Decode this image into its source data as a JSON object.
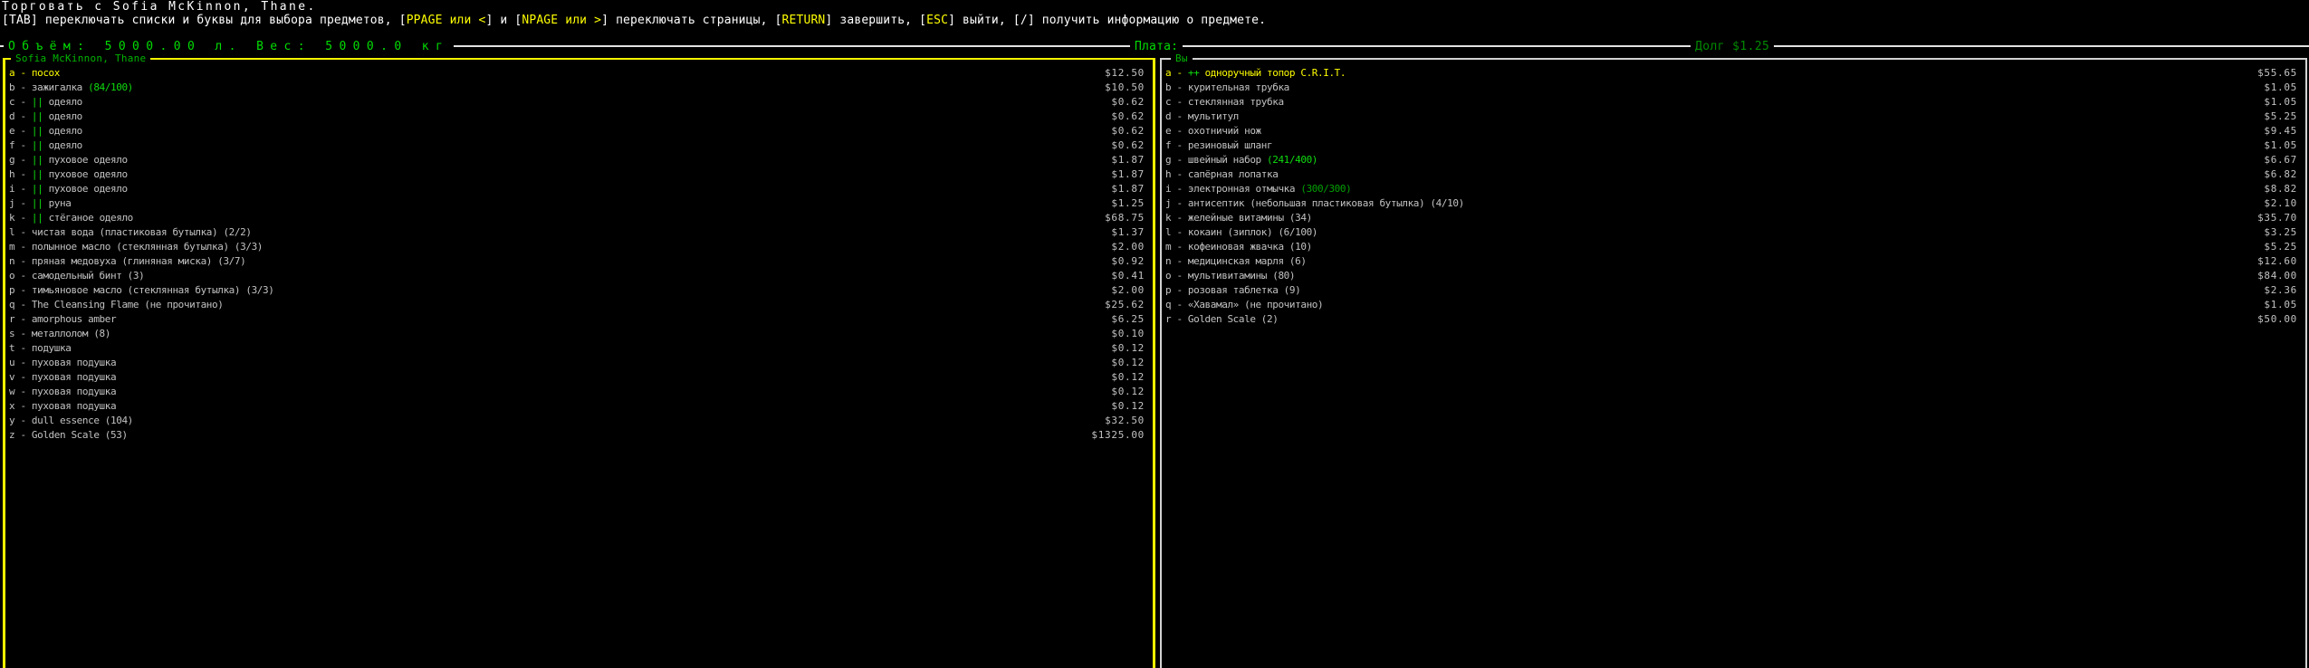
{
  "header": {
    "title": "Торговать с Sofia McKinnon, Thane.",
    "help_segments": [
      {
        "t": "[TAB] переключать списки и буквы для выбора предметов, ",
        "c": "white"
      },
      {
        "t": "[",
        "c": "white"
      },
      {
        "t": "PPAGE или <",
        "c": "yellow"
      },
      {
        "t": "]",
        "c": "white"
      },
      {
        "t": " и ",
        "c": "white"
      },
      {
        "t": "[",
        "c": "white"
      },
      {
        "t": "NPAGE или >",
        "c": "yellow"
      },
      {
        "t": "]",
        "c": "white"
      },
      {
        "t": " переключать страницы, ",
        "c": "white"
      },
      {
        "t": "[",
        "c": "white"
      },
      {
        "t": "RETURN",
        "c": "yellow"
      },
      {
        "t": "]",
        "c": "white"
      },
      {
        "t": " завершить, ",
        "c": "white"
      },
      {
        "t": "[",
        "c": "white"
      },
      {
        "t": "ESC",
        "c": "yellow"
      },
      {
        "t": "]",
        "c": "white"
      },
      {
        "t": " выйти, ",
        "c": "white"
      },
      {
        "t": "[/] получить информацию о предмете.",
        "c": "white"
      }
    ]
  },
  "status_bar": {
    "volume_weight": "Объём: 5000.00 л. Вес: 5000.0 кг",
    "payment_label": "Плата:",
    "debt_label": "Долг $1.25"
  },
  "colors": {
    "background": "#000000",
    "item_text": "#c2c2c2",
    "selected_text": "#fdfd00",
    "highlight_green": "#0fdc0f",
    "title_green": "#00b400",
    "debt_green": "#008a00",
    "active_border": "#f4f400",
    "inactive_border": "#d2d2d2"
  },
  "left_panel": {
    "title": "Sofia McKinnon, Thane",
    "items": [
      {
        "key": "a",
        "name": "посох",
        "price": "$12.50",
        "selected": true
      },
      {
        "key": "b",
        "name": "зажигалка",
        "charge": "(84/100)",
        "charge_color": "lgreen",
        "price": "$10.50"
      },
      {
        "key": "c",
        "prefix": "||",
        "name": "одеяло",
        "price": "$0.62"
      },
      {
        "key": "d",
        "prefix": "||",
        "name": "одеяло",
        "price": "$0.62"
      },
      {
        "key": "e",
        "prefix": "||",
        "name": "одеяло",
        "price": "$0.62"
      },
      {
        "key": "f",
        "prefix": "||",
        "name": "одеяло",
        "price": "$0.62"
      },
      {
        "key": "g",
        "prefix": "||",
        "name": "пуховое одеяло",
        "price": "$1.87"
      },
      {
        "key": "h",
        "prefix": "||",
        "name": "пуховое одеяло",
        "price": "$1.87"
      },
      {
        "key": "i",
        "prefix": "||",
        "name": "пуховое одеяло",
        "price": "$1.87"
      },
      {
        "key": "j",
        "prefix": "||",
        "name": "руна",
        "price": "$1.25"
      },
      {
        "key": "k",
        "prefix": "||",
        "name": "стёганое одеяло",
        "price": "$68.75"
      },
      {
        "key": "l",
        "name": "чистая вода (пластиковая бутылка) (2/2)",
        "price": "$1.37"
      },
      {
        "key": "m",
        "name": "полынное масло (стеклянная бутылка) (3/3)",
        "price": "$2.00"
      },
      {
        "key": "n",
        "name": "пряная медовуха (глиняная миска) (3/7)",
        "price": "$0.92"
      },
      {
        "key": "o",
        "name": "самодельный бинт (3)",
        "price": "$0.41"
      },
      {
        "key": "p",
        "name": "тимьяновое масло (стеклянная бутылка) (3/3)",
        "price": "$2.00"
      },
      {
        "key": "q",
        "name": "The Cleansing Flame (не прочитано)",
        "price": "$25.62"
      },
      {
        "key": "r",
        "name": "amorphous amber",
        "price": "$6.25"
      },
      {
        "key": "s",
        "name": "металлолом (8)",
        "price": "$0.10"
      },
      {
        "key": "t",
        "name": "подушка",
        "price": "$0.12"
      },
      {
        "key": "u",
        "name": "пуховая подушка",
        "price": "$0.12"
      },
      {
        "key": "v",
        "name": "пуховая подушка",
        "price": "$0.12"
      },
      {
        "key": "w",
        "name": "пуховая подушка",
        "price": "$0.12"
      },
      {
        "key": "x",
        "name": "пуховая подушка",
        "price": "$0.12"
      },
      {
        "key": "y",
        "name": "dull essence (104)",
        "price": "$32.50"
      },
      {
        "key": "z",
        "name": "Golden Scale (53)",
        "price": "$1325.00"
      }
    ]
  },
  "right_panel": {
    "title": "Вы",
    "items": [
      {
        "key": "a",
        "prefix": "++",
        "name": "одноручный топор C.R.I.T.",
        "price": "$55.65",
        "selected": true
      },
      {
        "key": "b",
        "name": "курительная трубка",
        "price": "$1.05"
      },
      {
        "key": "c",
        "name": "стеклянная трубка",
        "price": "$1.05"
      },
      {
        "key": "d",
        "name": "мультитул",
        "price": "$5.25"
      },
      {
        "key": "e",
        "name": "охотничий нож",
        "price": "$9.45"
      },
      {
        "key": "f",
        "name": "резиновый шланг",
        "price": "$1.05"
      },
      {
        "key": "g",
        "name": "швейный набор",
        "charge": "(241/400)",
        "charge_color": "lgreen",
        "price": "$6.67"
      },
      {
        "key": "h",
        "name": "сапёрная лопатка",
        "price": "$6.82"
      },
      {
        "key": "i",
        "name": "электронная отмычка",
        "charge": "(300/300)",
        "charge_color": "green",
        "price": "$8.82"
      },
      {
        "key": "j",
        "name": "антисептик (небольшая пластиковая бутылка) (4/10)",
        "price": "$2.10"
      },
      {
        "key": "k",
        "name": "желейные витамины (34)",
        "price": "$35.70"
      },
      {
        "key": "l",
        "name": "кокаин (зиплок) (6/100)",
        "price": "$3.25"
      },
      {
        "key": "m",
        "name": "кофеиновая жвачка (10)",
        "price": "$5.25"
      },
      {
        "key": "n",
        "name": "медицинская марля (6)",
        "price": "$12.60"
      },
      {
        "key": "o",
        "name": "мультивитамины (80)",
        "price": "$84.00"
      },
      {
        "key": "p",
        "name": "розовая таблетка (9)",
        "price": "$2.36"
      },
      {
        "key": "q",
        "name": "«Хавамал» (не прочитано)",
        "price": "$1.05"
      },
      {
        "key": "r",
        "name": "Golden Scale (2)",
        "price": "$50.00"
      }
    ]
  }
}
